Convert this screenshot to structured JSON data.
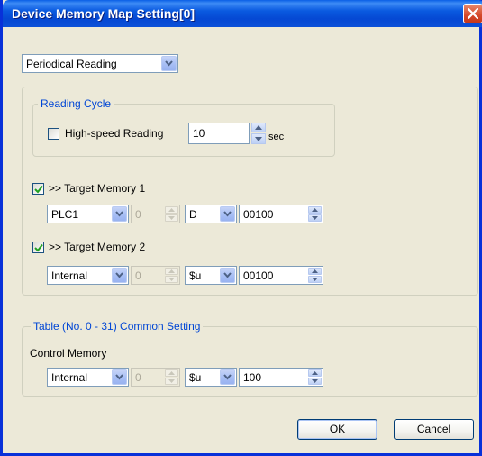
{
  "window": {
    "title": "Device Memory Map Setting[0]"
  },
  "mode_select": {
    "value": "Periodical Reading"
  },
  "reading_cycle": {
    "legend": "Reading Cycle",
    "high_speed": {
      "label": "High-speed Reading",
      "checked": false
    },
    "interval": {
      "value": "10",
      "unit": "sec"
    }
  },
  "targets": [
    {
      "label": ">> Target Memory 1",
      "checked": true,
      "device": "PLC1",
      "station": "0",
      "type": "D",
      "address": "00100"
    },
    {
      "label": ">> Target Memory 2",
      "checked": true,
      "device": "Internal",
      "station": "0",
      "type": "$u",
      "address": "00100"
    }
  ],
  "common": {
    "legend": "Table (No. 0 - 31) Common Setting",
    "control_label": "Control Memory",
    "device": "Internal",
    "station": "0",
    "type": "$u",
    "address": "100"
  },
  "buttons": {
    "ok": "OK",
    "cancel": "Cancel"
  },
  "colors": {
    "titlebar": "#0548d3",
    "dialog_bg": "#ece9d8",
    "legend_text": "#0046d5",
    "checkmark": "#21a121"
  }
}
